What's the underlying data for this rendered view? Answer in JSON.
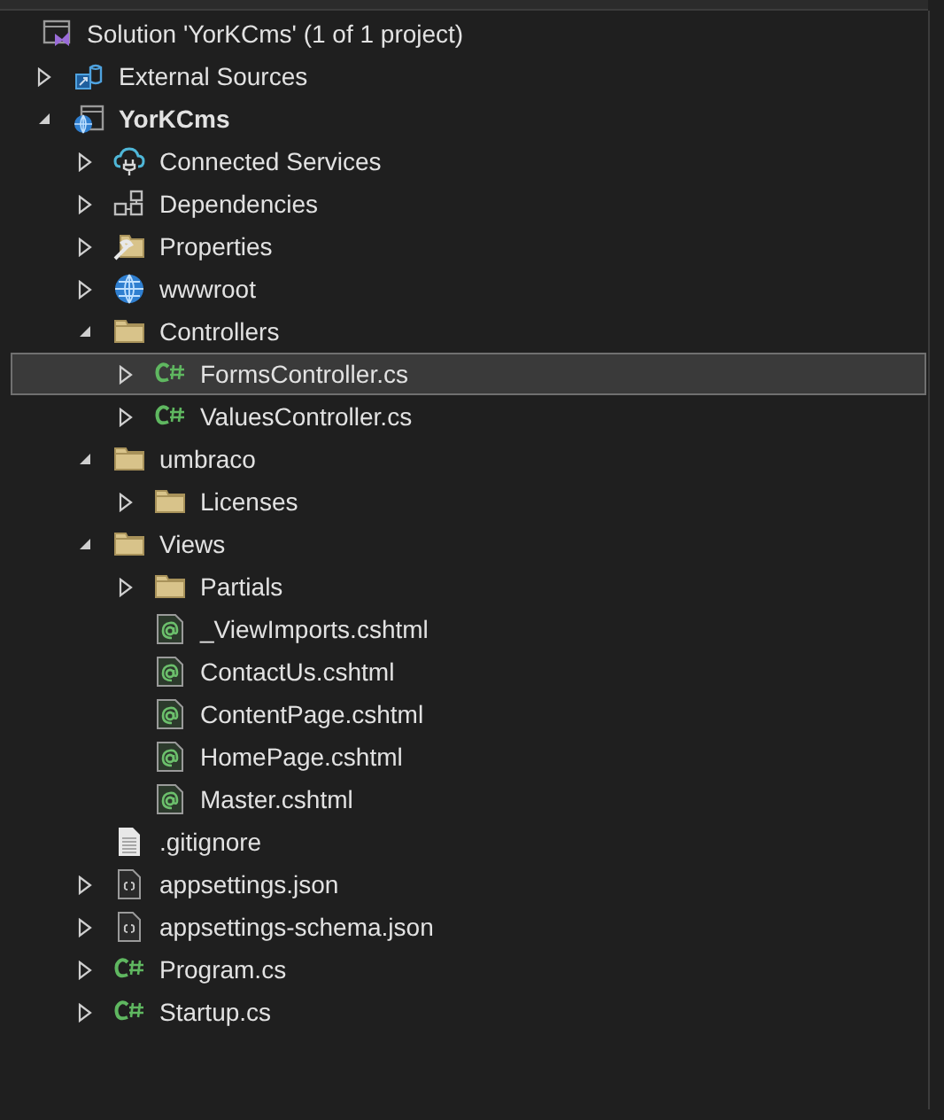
{
  "tree": [
    {
      "label": "Solution 'YorKCms' (1 of 1 project)",
      "kind": "solution",
      "selected": false,
      "children": [
        {
          "label": "External Sources",
          "kind": "external",
          "expanded": false,
          "selected": false
        },
        {
          "label": "YorKCms",
          "kind": "project",
          "bold": true,
          "expanded": true,
          "selected": false,
          "children": [
            {
              "label": "Connected Services",
              "kind": "cloud",
              "expanded": false,
              "selected": false
            },
            {
              "label": "Dependencies",
              "kind": "dependencies",
              "expanded": false,
              "selected": false
            },
            {
              "label": "Properties",
              "kind": "properties",
              "expanded": false,
              "selected": false
            },
            {
              "label": "wwwroot",
              "kind": "globe",
              "expanded": false,
              "selected": false
            },
            {
              "label": "Controllers",
              "kind": "folder",
              "expanded": true,
              "selected": false,
              "children": [
                {
                  "label": "FormsController.cs",
                  "kind": "csharp",
                  "expanded": false,
                  "selected": true
                },
                {
                  "label": "ValuesController.cs",
                  "kind": "csharp",
                  "expanded": false,
                  "selected": false
                }
              ]
            },
            {
              "label": "umbraco",
              "kind": "folder",
              "expanded": true,
              "selected": false,
              "children": [
                {
                  "label": "Licenses",
                  "kind": "folder",
                  "expanded": false,
                  "selected": false
                }
              ]
            },
            {
              "label": "Views",
              "kind": "folder",
              "expanded": true,
              "selected": false,
              "children": [
                {
                  "label": "Partials",
                  "kind": "folder",
                  "expanded": false,
                  "selected": false
                },
                {
                  "label": "_ViewImports.cshtml",
                  "kind": "razor",
                  "selected": false
                },
                {
                  "label": "ContactUs.cshtml",
                  "kind": "razor",
                  "selected": false
                },
                {
                  "label": "ContentPage.cshtml",
                  "kind": "razor",
                  "selected": false
                },
                {
                  "label": "HomePage.cshtml",
                  "kind": "razor",
                  "selected": false
                },
                {
                  "label": "Master.cshtml",
                  "kind": "razor",
                  "selected": false
                }
              ]
            },
            {
              "label": ".gitignore",
              "kind": "text",
              "selected": false
            },
            {
              "label": "appsettings.json",
              "kind": "json",
              "expanded": false,
              "selected": false
            },
            {
              "label": "appsettings-schema.json",
              "kind": "json",
              "expanded": false,
              "selected": false
            },
            {
              "label": "Program.cs",
              "kind": "csharp",
              "expanded": false,
              "selected": false
            },
            {
              "label": "Startup.cs",
              "kind": "csharp",
              "expanded": false,
              "selected": false
            }
          ]
        }
      ]
    }
  ]
}
